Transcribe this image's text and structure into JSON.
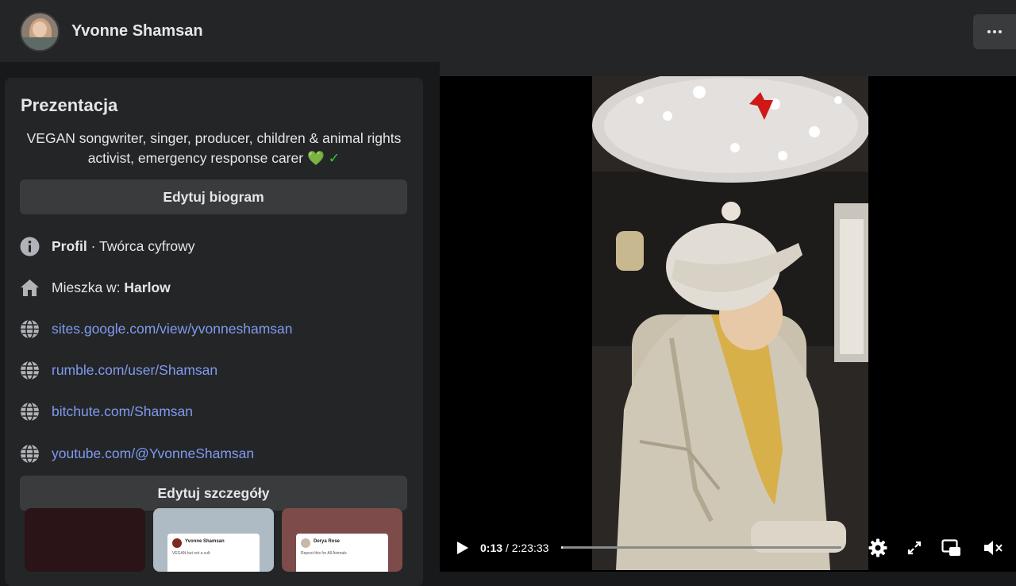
{
  "header": {
    "page_name": "Yvonne Shamsan",
    "more_icon": "more-horizontal-icon"
  },
  "intro": {
    "title": "Prezentacja",
    "bio": "VEGAN songwriter, singer, producer, children & animal rights activist, emergency response carer",
    "bio_emojis": [
      "💚",
      "✓"
    ],
    "edit_bio_label": "Edytuj biogram",
    "details": [
      {
        "icon": "info-icon",
        "strong": "Profil",
        "text": " · Twórca cyfrowy"
      },
      {
        "icon": "home-icon",
        "text": "Mieszka w: ",
        "strong": "Harlow"
      }
    ],
    "links": [
      {
        "icon": "globe-icon",
        "label": "sites.google.com/view/yvonneshamsan"
      },
      {
        "icon": "globe-icon",
        "label": "rumble.com/user/Shamsan"
      },
      {
        "icon": "globe-icon",
        "label": "bitchute.com/Shamsan"
      },
      {
        "icon": "globe-icon",
        "label": "youtube.com/@YvonneShamsan"
      }
    ],
    "edit_details_label": "Edytuj szczegóły",
    "featured": [
      {
        "bg": "#2a1418"
      },
      {
        "bg": "#aebbc4",
        "card_name": "Yvonne Shamsan",
        "card_text": "VEGAN but not a cult"
      },
      {
        "bg": "#7d4c4a",
        "card_name": "Derya Rose",
        "card_text": "Repost this for All Animals"
      }
    ]
  },
  "video": {
    "current_time": "0:13",
    "duration": "2:23:33",
    "progress": 0.0015,
    "icons": [
      "play-icon",
      "settings-icon",
      "fullscreen-icon",
      "picture-in-picture-icon",
      "mute-icon"
    ]
  },
  "colors": {
    "link": "#7f9bf0",
    "surface": "#242526",
    "button": "#3a3b3c",
    "background": "#18191a",
    "emoji_green": "#2ecc2e"
  }
}
